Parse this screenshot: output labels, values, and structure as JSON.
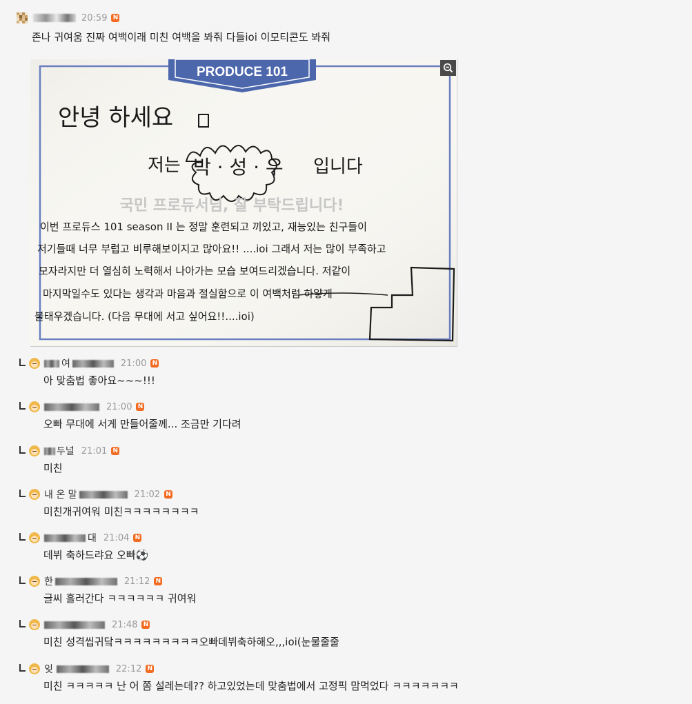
{
  "post": {
    "time": "20:59",
    "badge": "N",
    "text": "존나 귀여움 진짜 여백이래 미친 여백을 봐줘 다들ioi 이모티콘도 봐줘"
  },
  "image": {
    "header_logo": "PRODUCE 101",
    "printed_line": "국민 프로듀서님, 잘 부탁드립니다!",
    "hand_line1": "안녕 하세요",
    "hand_intro_left": "저는",
    "hand_name": "박 · 성 · 우",
    "hand_intro_right": "입니다",
    "hand_body": [
      "이번 프로듀스 101 season II 는 정말 훈련되고 끼있고, 재능있는 친구들이",
      "저기들때 너무 부럽고 비루해보이지고 많아요!! ....ioi 그래서 저는 많이 부족하고",
      "모자라지만 더 열심히 노력해서 나아가는 모습 보여드리겠습니다. 저같이",
      "마지막일수도 있다는 생각과 마음과 절실함으로 이 여백처럼 하얗게",
      "불태우겠습니다. (다음 무대에 서고 싶어요!!....ioi)"
    ]
  },
  "comments": [
    {
      "nick": "여",
      "time": "21:00",
      "badge": "N",
      "text": "아 맞춤법 좋아요~~~!!!"
    },
    {
      "nick": "",
      "time": "21:00",
      "badge": "N",
      "text": "오빠 무대에 서게 만들어줄께... 조금만 기다려"
    },
    {
      "nick": "두널",
      "time": "21:01",
      "badge": "N",
      "text": "미친"
    },
    {
      "nick": "내 온 말",
      "time": "21:02",
      "badge": "N",
      "text": "미친개귀여워 미친ㅋㅋㅋㅋㅋㅋㅋㅋ"
    },
    {
      "nick": "대",
      "time": "21:04",
      "badge": "N",
      "text": "데뷔 축하드랴요 오빠⚽"
    },
    {
      "nick": "한",
      "time": "21:12",
      "badge": "N",
      "text": "글씨 흘러간다 ㅋㅋㅋㅋㅋㅋ 귀여워"
    },
    {
      "nick": "",
      "time": "21:48",
      "badge": "N",
      "text": "미친 성격씹귀닼ㅋㅋㅋㅋㅋㅋㅋㅋㅋ오빠데뷔축하해오,,,ioi(눈물줄줄"
    },
    {
      "nick": "잊",
      "time": "22:12",
      "badge": "N",
      "text": "미친 ㅋㅋㅋㅋㅋ 난 어 쫌 설레는데?? 하고있었는데 맞춤법에서 고정픽 맘먹었다 ㅋㅋㅋㅋㅋㅋㅋ"
    }
  ],
  "colors": {
    "badge": "#f26b21",
    "time": "#999999",
    "ink": "#1a1a1a",
    "frame_blue": "#5a6fb5"
  },
  "icons": {
    "zoom": "zoom-out-icon",
    "badge": "new-badge-icon",
    "avatar": "avatar-icon"
  }
}
